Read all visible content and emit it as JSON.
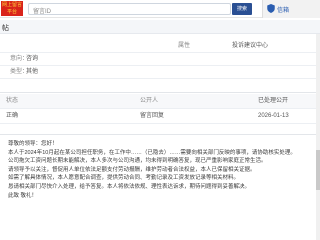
{
  "header": {
    "logo_text": "网上留言 平台",
    "search_placeholder": "留言ID",
    "search_button": "搜索",
    "user_name": "信箱"
  },
  "title": {
    "text": "帖"
  },
  "form": {
    "r1": {
      "right_label": "属性",
      "right_value": "投诉建议中心"
    },
    "r2": {
      "left_label": "意向：",
      "left_value": "咨询"
    },
    "r3": {
      "left_label": "类型：",
      "left_value": "其他"
    },
    "r4": {
      "left_label": "状态",
      "mid_label": "公开人",
      "mid_value": "",
      "right_value": "已处理公开"
    },
    "r5": {
      "left_value": "正确",
      "mid_value": "留言回复",
      "right_value": "2026-01-13"
    }
  },
  "message": {
    "lines": [
      "尊敬的领导：您好！",
      "本人于2024年10月起在某公司担任职务，在工作中……（已隐去）……需要向相关部门反映的事项，请协助核实处理。",
      "公司拖欠工资问题长期未能解决，本人多次与公司沟通，均未得到明确答复，现已严重影响家庭正常生活。",
      "请领导予以关注，督促用人单位依法足额支付劳动报酬，维护劳动者合法权益，本人已保留相关证据。",
      "如需了解具体情况，本人愿意配合调查，提供劳动合同、考勤记录及工资发放记录等相关材料。",
      "恳请相关部门尽快介入处理，给予答复。本人将依法依规、理性表达诉求，期待问题得到妥善解决。",
      "此致 敬礼！"
    ]
  },
  "colors": {
    "logo_bg": "#d9241b",
    "search_btn": "#2a4f93",
    "link": "#2a5db0"
  }
}
